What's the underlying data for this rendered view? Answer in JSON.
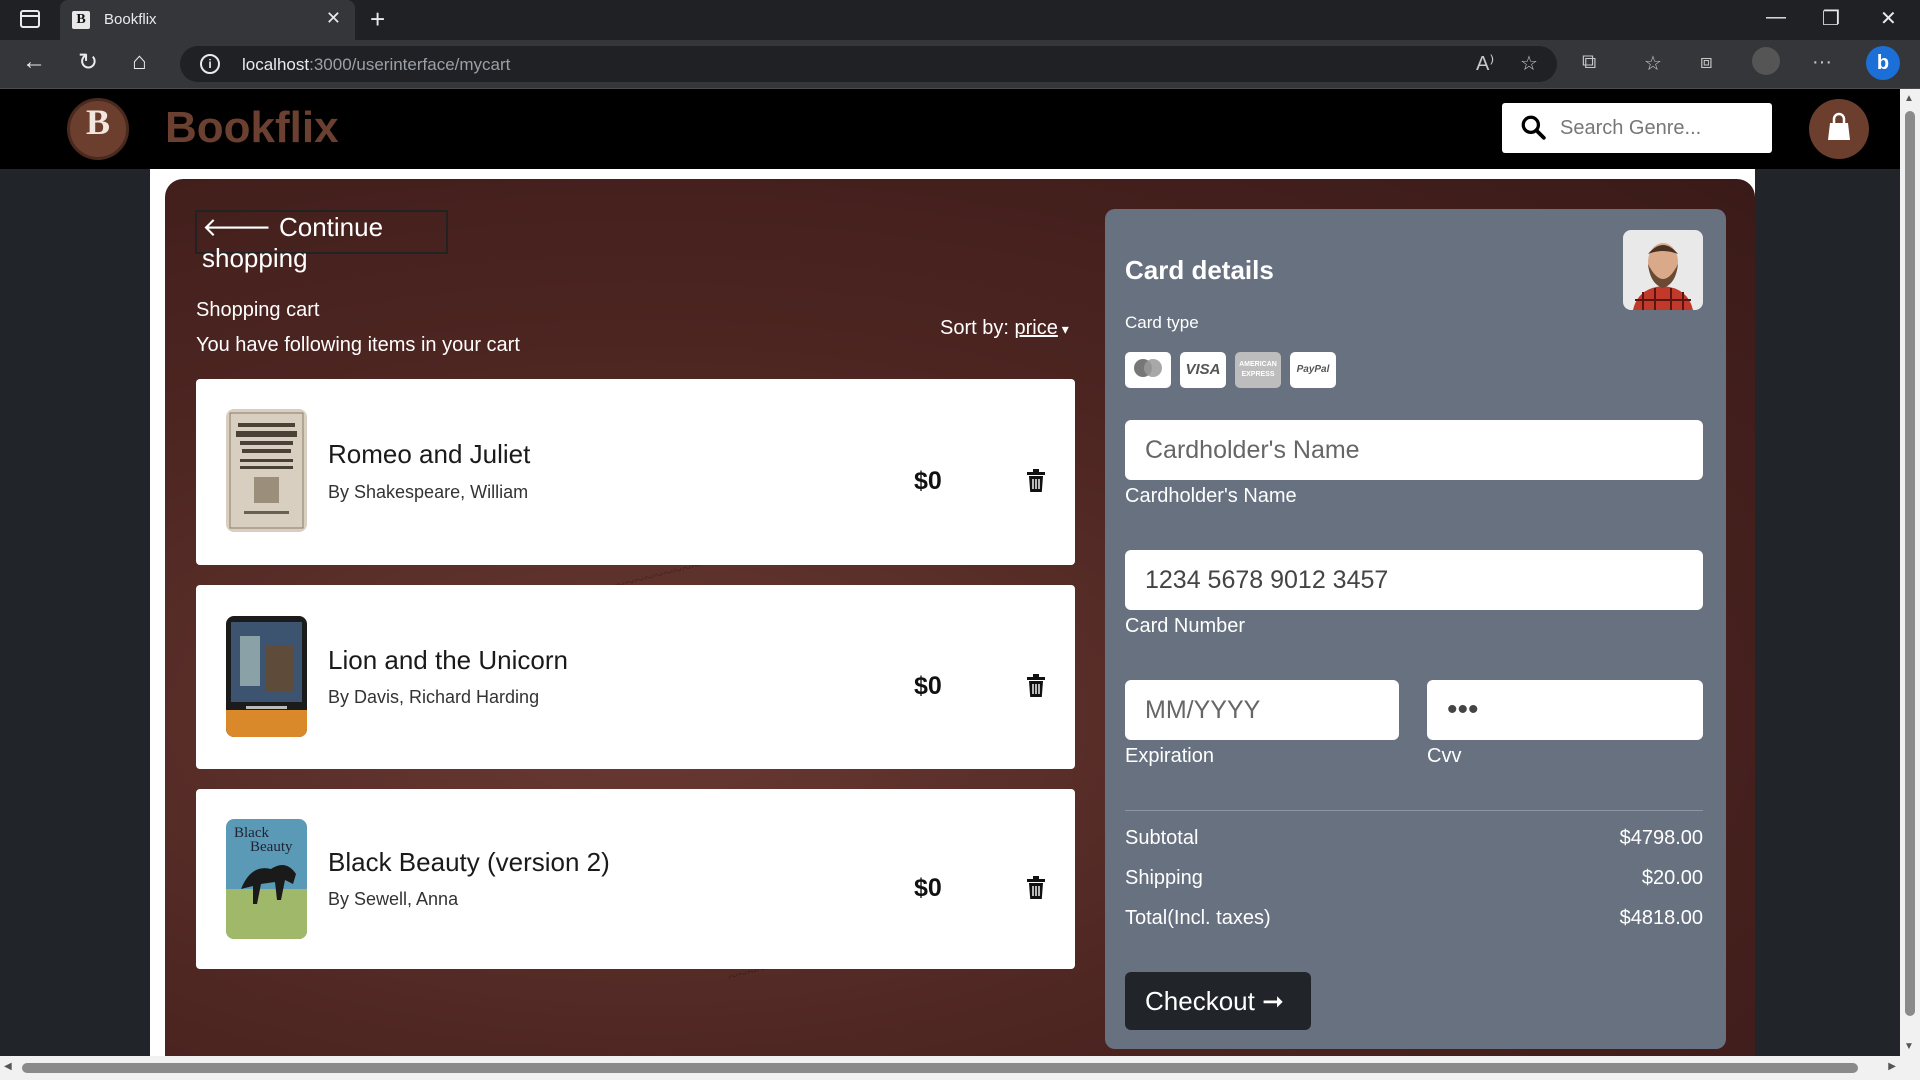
{
  "browser": {
    "tab_title": "Bookflix",
    "url_host": "localhost",
    "url_path": ":3000/userinterface/mycart"
  },
  "header": {
    "logo_letter": "B",
    "brand": "Bookflix",
    "search_placeholder": "Search Genre..."
  },
  "cart": {
    "continue_label": "Continue shopping",
    "title": "Shopping cart",
    "subtitle": "You have following items in your cart",
    "sort_label": "Sort by:",
    "sort_value": "price",
    "items": [
      {
        "title": "Romeo and Juliet",
        "author": "By Shakespeare, William",
        "price": "$0"
      },
      {
        "title": "Lion and the Unicorn",
        "author": "By Davis, Richard Harding",
        "price": "$0"
      },
      {
        "title": "Black Beauty (version 2)",
        "author": "By Sewell, Anna",
        "price": "$0"
      }
    ]
  },
  "card": {
    "title": "Card details",
    "card_type_label": "Card type",
    "card_types": [
      "mastercard",
      "VISA",
      "AMERICAN EXPRESS",
      "PayPal"
    ],
    "name_placeholder": "Cardholder's Name",
    "name_label": "Cardholder's Name",
    "number_value": "1234 5678 9012 3457",
    "number_label": "Card Number",
    "expiration_placeholder": "MM/YYYY",
    "expiration_label": "Expiration",
    "cvv_value": "•••",
    "cvv_label": "Cvv",
    "subtotal_label": "Subtotal",
    "subtotal_value": "$4798.00",
    "shipping_label": "Shipping",
    "shipping_value": "$20.00",
    "total_label": "Total(Incl. taxes)",
    "total_value": "$4818.00",
    "checkout_label": "Checkout"
  },
  "colors": {
    "brand": "#6b4030",
    "card_panel": "#687180",
    "page_bg": "#212529"
  }
}
